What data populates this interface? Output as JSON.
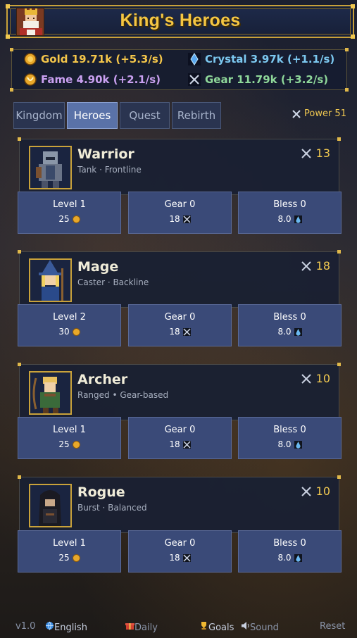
{
  "header": {
    "title": "King's Heroes"
  },
  "resources": {
    "gold": "Gold 19.71k (+5.3/s)",
    "crystal": "Crystal 3.97k (+1.1/s)",
    "fame": "Fame 4.90k (+2.1/s)",
    "gear": "Gear 11.79k (+3.2/s)"
  },
  "tabs": [
    {
      "label": "Kingdom"
    },
    {
      "label": "Heroes",
      "active": true
    },
    {
      "label": "Quest"
    },
    {
      "label": "Rebirth"
    }
  ],
  "power_label": "Power 51",
  "heroes": [
    {
      "name": "Warrior",
      "role": "Tank · Frontline",
      "power": "13",
      "level": "Level 1",
      "level_cost": "25",
      "gear": "Gear 0",
      "gear_cost": "18",
      "bless": "Bless 0",
      "bless_cost": "8.0"
    },
    {
      "name": "Mage",
      "role": "Caster · Backline",
      "power": "18",
      "level": "Level 2",
      "level_cost": "30",
      "gear": "Gear 0",
      "gear_cost": "18",
      "bless": "Bless 0",
      "bless_cost": "8.0"
    },
    {
      "name": "Archer",
      "role": "Ranged • Gear-based",
      "power": "10",
      "level": "Level 1",
      "level_cost": "25",
      "gear": "Gear 0",
      "gear_cost": "18",
      "bless": "Bless 0",
      "bless_cost": "8.0"
    },
    {
      "name": "Rogue",
      "role": "Burst · Balanced",
      "power": "10",
      "level": "Level 1",
      "level_cost": "25",
      "gear": "Gear 0",
      "gear_cost": "18",
      "bless": "Bless 0",
      "bless_cost": "8.0"
    }
  ],
  "footer": {
    "version": "v1.0",
    "language": "English",
    "daily": "Daily",
    "goals": "Goals",
    "sound": "Sound",
    "reset": "Reset"
  },
  "colors": {
    "gold": "#f4c64a",
    "crystal": "#7cc8f0",
    "fame": "#c9a0f0",
    "gear": "#8fd89a",
    "accent": "#c9a23a"
  }
}
